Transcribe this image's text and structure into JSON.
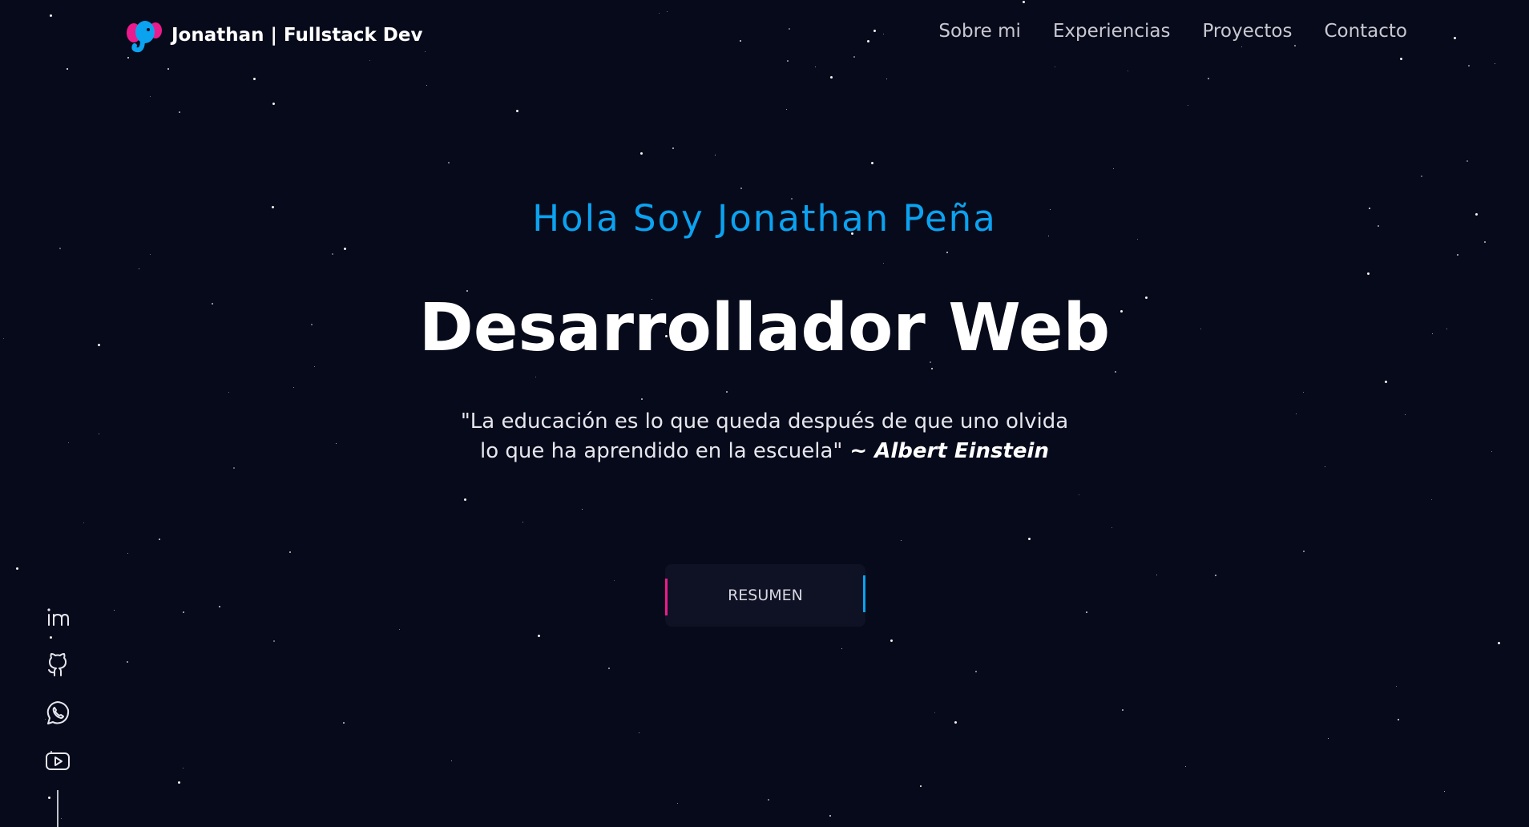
{
  "brand": {
    "name": "Jonathan  | Fullstack Dev",
    "logo_icon": "elephant-logo-icon",
    "colors": {
      "pink": "#ec1b8d",
      "blue": "#0ba2f0"
    }
  },
  "nav": {
    "items": [
      {
        "label": "Sobre mi"
      },
      {
        "label": "Experiencias"
      },
      {
        "label": "Proyectos"
      },
      {
        "label": "Contacto"
      }
    ]
  },
  "hero": {
    "greeting": "Hola Soy Jonathan Peña",
    "headline": "Desarrollador Web",
    "quote_line1": "\"La educación es lo que queda después de que uno olvida",
    "quote_line2": "lo que ha aprendido en la escuela\"",
    "quote_author": " ~ Albert Einstein",
    "cta_label": "RESUMEN"
  },
  "social": {
    "icons": [
      "linkedin-icon",
      "github-icon",
      "whatsapp-icon",
      "youtube-icon"
    ]
  },
  "theme": {
    "background": "#070a1a",
    "accent_blue": "#0ba2f0",
    "accent_pink": "#ec1b8d"
  }
}
